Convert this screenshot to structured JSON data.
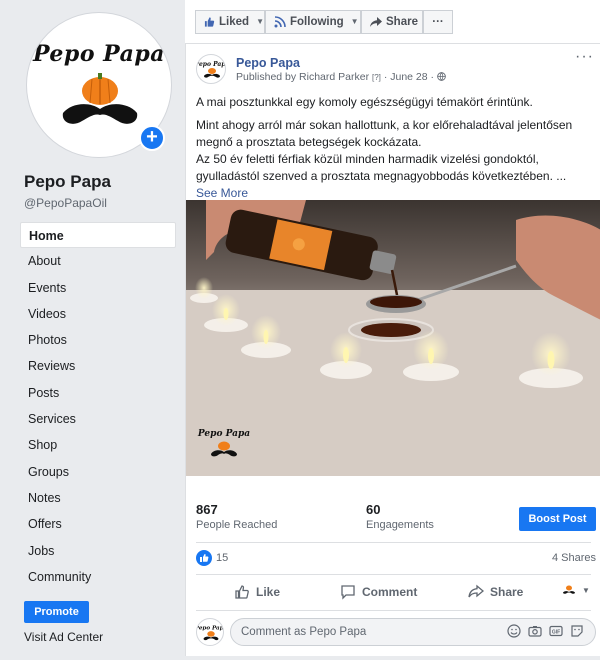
{
  "page": {
    "name": "Pepo Papa",
    "handle": "@PepoPapaOil",
    "logo_text": "Pepo Papa"
  },
  "sidebar": {
    "items": [
      {
        "label": "Home",
        "active": true
      },
      {
        "label": "About"
      },
      {
        "label": "Events"
      },
      {
        "label": "Videos"
      },
      {
        "label": "Photos"
      },
      {
        "label": "Reviews"
      },
      {
        "label": "Posts"
      },
      {
        "label": "Services"
      },
      {
        "label": "Shop"
      },
      {
        "label": "Groups"
      },
      {
        "label": "Notes"
      },
      {
        "label": "Offers"
      },
      {
        "label": "Jobs"
      },
      {
        "label": "Community"
      }
    ],
    "promote_label": "Promote",
    "ad_center_label": "Visit Ad Center"
  },
  "topbar": {
    "liked_label": "Liked",
    "following_label": "Following",
    "share_label": "Share",
    "more_label": "···"
  },
  "post": {
    "author": "Pepo Papa",
    "published_by": "Published by Richard Parker",
    "help_mark": "[?]",
    "date": "June 28",
    "more_label": "···",
    "paragraph1": "A mai posztunkkal egy komoly egészségügyi témakört érintünk.",
    "paragraph2": "Mint ahogy arról már sokan hallottunk, a kor előrehaladtával jelentősen megnő a prosztata betegségek kockázata.",
    "paragraph3": "Az 50 év feletti férfiak közül minden harmadik vizelési gondoktól, gyulladástól szenved a prosztata megnagyobbodás következtében. ...",
    "see_more": "See More",
    "photo_watermark": "Pepo Papa"
  },
  "insights": {
    "reached_count": "867",
    "reached_label": "People Reached",
    "engagements_count": "60",
    "engagements_label": "Engagements",
    "boost_label": "Boost Post"
  },
  "reactions": {
    "count": "15",
    "shares": "4 Shares"
  },
  "actions": {
    "like": "Like",
    "comment": "Comment",
    "share": "Share"
  },
  "comment": {
    "placeholder": "Comment as Pepo Papa"
  },
  "colors": {
    "accent": "#1877f2",
    "link": "#385898",
    "background": "#e9ebee"
  }
}
